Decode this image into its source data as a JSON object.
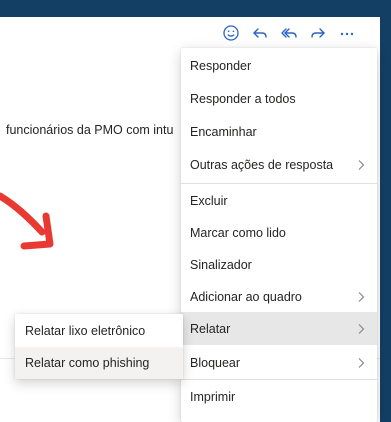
{
  "colors": {
    "background": "#123f63",
    "accent": "#2b64c3",
    "annotation_arrow": "#e83a32"
  },
  "message": {
    "preview_text": "funcionários da PMO com intu"
  },
  "toolbar": {
    "icons": [
      "smiley-icon",
      "reply-icon",
      "reply-all-icon",
      "forward-icon",
      "more-icon"
    ],
    "more_label": "..."
  },
  "context_menu": {
    "items": [
      {
        "label": "Responder",
        "has_submenu": false
      },
      {
        "label": "Responder a todos",
        "has_submenu": false
      },
      {
        "label": "Encaminhar",
        "has_submenu": false
      },
      {
        "label": "Outras ações de resposta",
        "has_submenu": true
      },
      {
        "label": "Excluir",
        "has_submenu": false
      },
      {
        "label": "Marcar como lido",
        "has_submenu": false
      },
      {
        "label": "Sinalizador",
        "has_submenu": false
      },
      {
        "label": "Adicionar ao quadro",
        "has_submenu": true
      },
      {
        "label": "Relatar",
        "has_submenu": true,
        "active": true
      },
      {
        "label": "Bloquear",
        "has_submenu": true
      },
      {
        "label": "Imprimir",
        "has_submenu": false
      }
    ]
  },
  "report_submenu": {
    "items": [
      {
        "label": "Relatar lixo eletrônico"
      },
      {
        "label": "Relatar como phishing"
      }
    ]
  }
}
